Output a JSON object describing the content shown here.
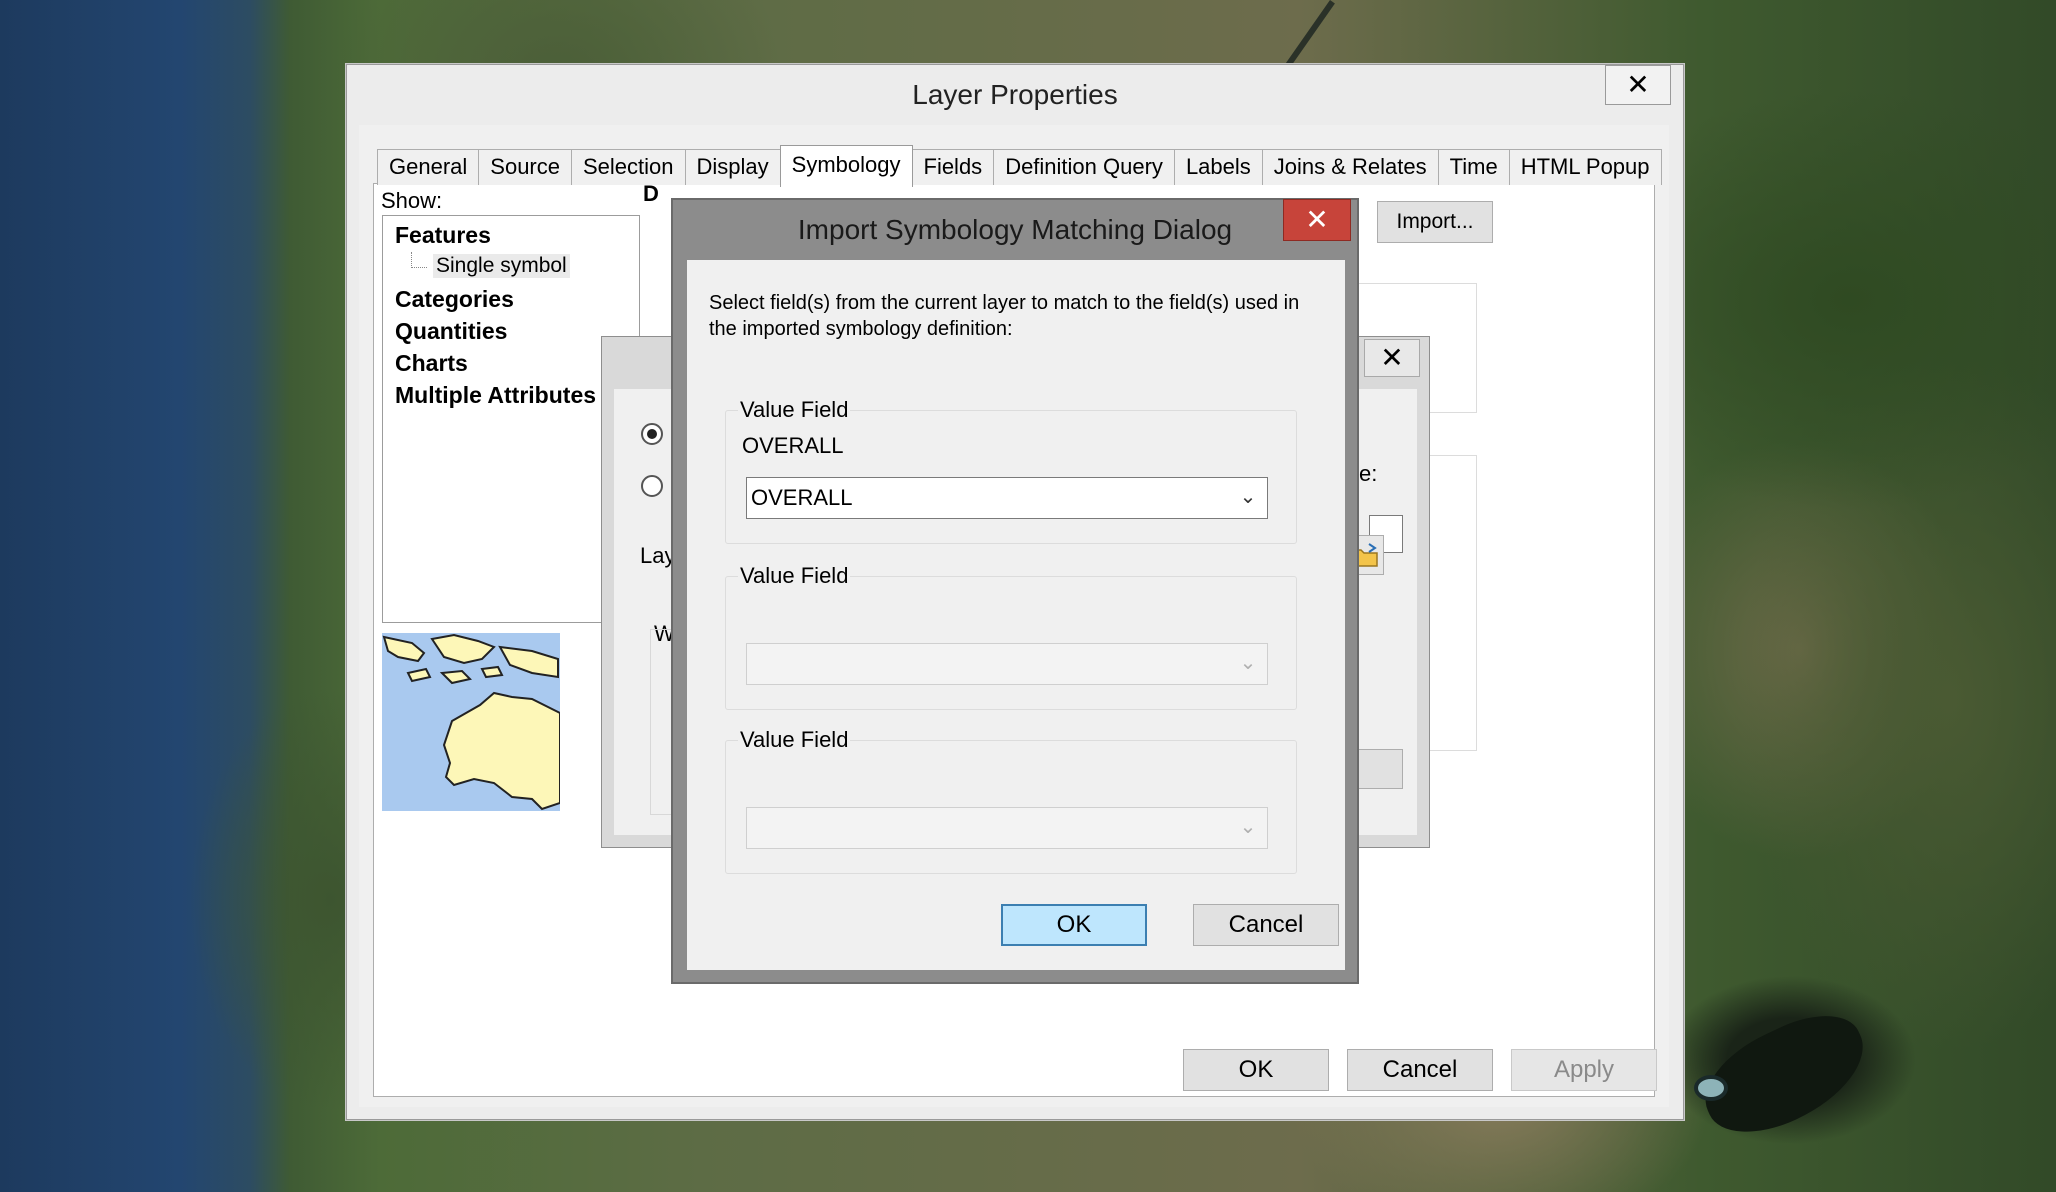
{
  "layer_properties": {
    "title": "Layer Properties",
    "close_glyph": "✕",
    "tabs": [
      {
        "label": "General"
      },
      {
        "label": "Source"
      },
      {
        "label": "Selection"
      },
      {
        "label": "Display"
      },
      {
        "label": "Symbology",
        "active": true
      },
      {
        "label": "Fields"
      },
      {
        "label": "Definition Query"
      },
      {
        "label": "Labels"
      },
      {
        "label": "Joins & Relates"
      },
      {
        "label": "Time"
      },
      {
        "label": "HTML Popup"
      }
    ],
    "show_label": "Show:",
    "show_tree": {
      "features": "Features",
      "single_symbol": "Single symbol",
      "categories": "Categories",
      "quantities": "Quantities",
      "charts": "Charts",
      "multiple_attributes": "Multiple Attributes"
    },
    "import_button": "Import...",
    "partial_label_d": "D",
    "buttons": {
      "ok": "OK",
      "cancel": "Cancel",
      "apply": "Apply"
    }
  },
  "background_dialog": {
    "close_glyph": "✕",
    "partial_label_lay": "Lay",
    "partial_label_w": "W",
    "partial_label_e": "e:"
  },
  "import_dialog": {
    "title": "Import Symbology Matching Dialog",
    "close_glyph": "✕",
    "instructions": "Select field(s) from the current layer to match to the field(s) used in the imported symbology definition:",
    "value_fields": [
      {
        "label": "Value Field",
        "source_field": "OVERALL",
        "selected": "OVERALL",
        "enabled": true
      },
      {
        "label": "Value Field",
        "source_field": "",
        "selected": "",
        "enabled": false
      },
      {
        "label": "Value Field",
        "source_field": "",
        "selected": "",
        "enabled": false
      }
    ],
    "buttons": {
      "ok": "OK",
      "cancel": "Cancel"
    }
  },
  "colors": {
    "accent_default_button": "#bee6fd",
    "close_button_red": "#c7443a",
    "map_land": "#fdf7b8",
    "map_water": "#a9c9ef"
  },
  "icons": {
    "combo_arrow": "⌄",
    "folder": "folder-icon"
  }
}
